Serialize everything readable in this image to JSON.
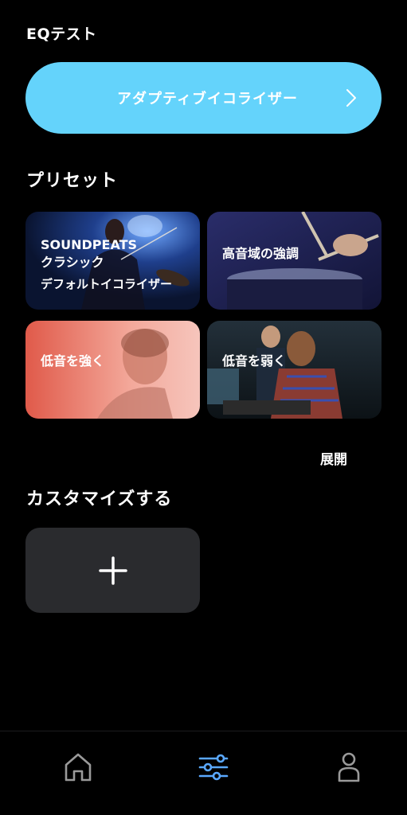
{
  "eq_test": {
    "title": "EQテスト"
  },
  "adaptive": {
    "label": "アダプティブイコライザー",
    "color": "#64d3fb"
  },
  "presets": {
    "title": "プリセット",
    "cards": [
      {
        "lines": [
          "SOUNDPEATS",
          "クラシック",
          "デフォルトイコライザー"
        ]
      },
      {
        "lines": [
          "高音域の強調"
        ]
      },
      {
        "lines": [
          "低音を強く"
        ]
      },
      {
        "lines": [
          "低音を弱く"
        ]
      }
    ],
    "expand_label": "展開"
  },
  "custom": {
    "title": "カスタマイズする",
    "add_icon": "plus-icon"
  },
  "tabbar": {
    "active_color": "#5aa8ff",
    "inactive_color": "#9a9a9a",
    "tabs": [
      {
        "icon": "home-icon",
        "active": false
      },
      {
        "icon": "equalizer-icon",
        "active": true
      },
      {
        "icon": "profile-icon",
        "active": false
      }
    ]
  }
}
